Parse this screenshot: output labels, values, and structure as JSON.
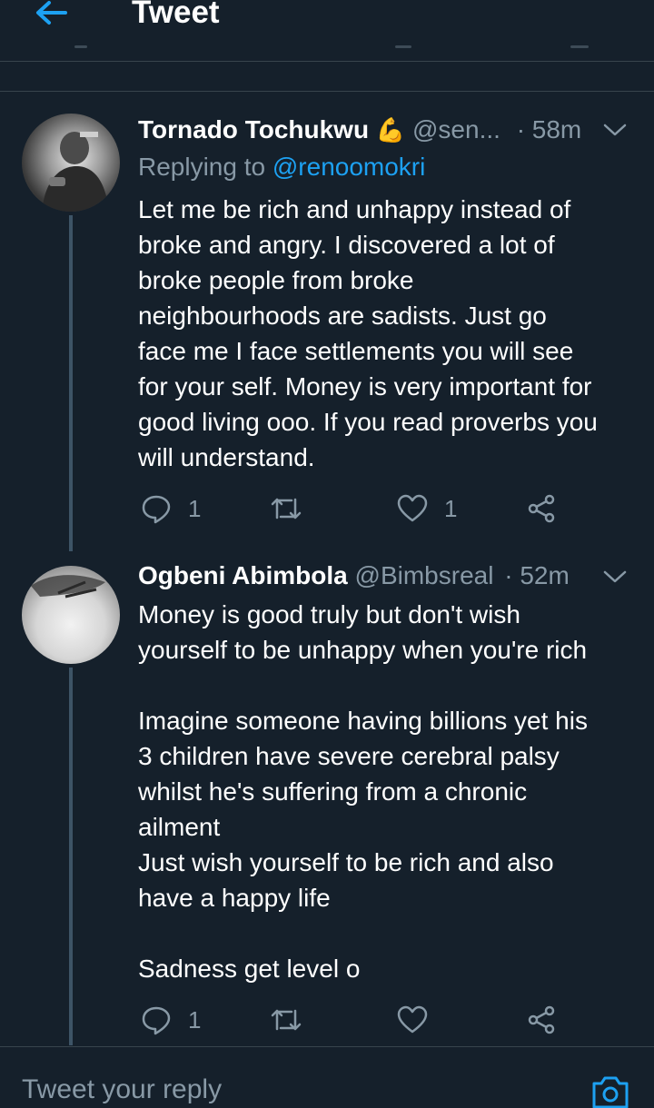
{
  "header": {
    "title": "Tweet"
  },
  "tweets": [
    {
      "name": "Tornado Tochukwu",
      "emoji": "💪",
      "handle": "@sen...",
      "time": "· 58m",
      "replying_prefix": "Replying to ",
      "replying_mention": "@renoomokri",
      "text": "Let me be rich and unhappy instead of\nbroke and angry. I discovered a lot of\nbroke people from broke\nneighbourhoods are sadists. Just go\nface me I face settlements you will see\nfor your self. Money is very important for\ngood living ooo. If you read proverbs you\nwill understand.",
      "reply_count": "1",
      "like_count": "1"
    },
    {
      "name": "Ogbeni Abimbola",
      "handle": "@Bimbsreal",
      "time": "· 52m",
      "text": "Money is good truly but don't wish\nyourself to be unhappy when you're rich\n\nImagine someone having billions yet his\n3 children have severe cerebral palsy\nwhilst he's suffering from a chronic\nailment\nJust wish yourself to be rich and also\nhave a happy life\n\nSadness get level o",
      "reply_count": "1"
    }
  ],
  "composer": {
    "placeholder": "Tweet your reply"
  },
  "colors": {
    "accent": "#1da1f2",
    "background": "#15202b",
    "muted": "#8899a6"
  }
}
